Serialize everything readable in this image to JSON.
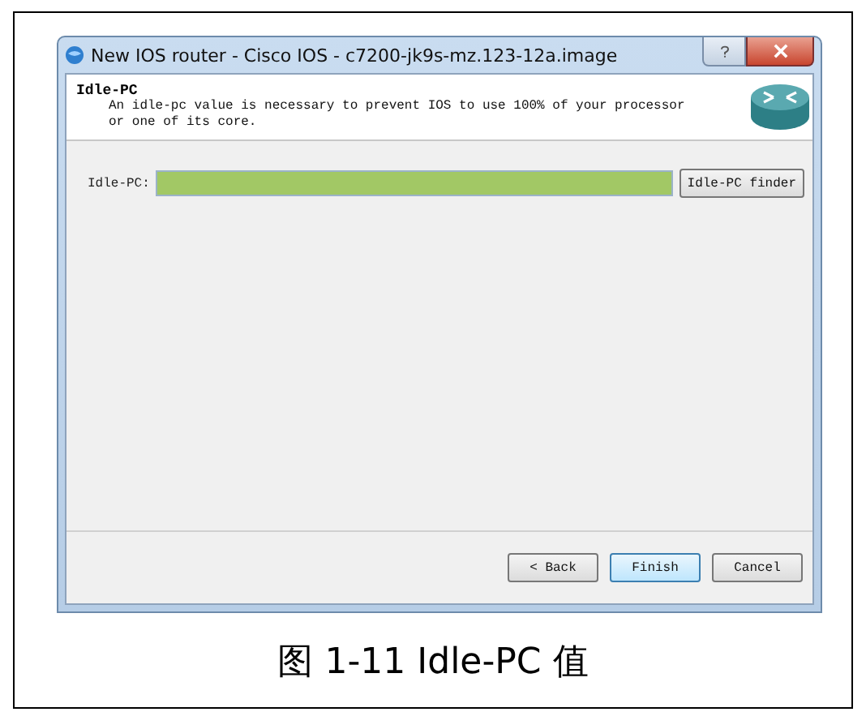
{
  "window": {
    "title": "New IOS router - Cisco IOS - c7200-jk9s-mz.123-12a.image"
  },
  "header": {
    "title": "Idle-PC",
    "description": "An idle-pc value is necessary to prevent IOS to use 100% of your processor or one of its core."
  },
  "idle_pc": {
    "label": "Idle-PC:",
    "finder_button": "Idle-PC finder"
  },
  "buttons": [
    {
      "label": "< Back",
      "kind": "normal"
    },
    {
      "label": "Finish",
      "kind": "default"
    },
    {
      "label": "Cancel",
      "kind": "normal"
    }
  ],
  "caption": "图 1-11 Idle-PC 值"
}
